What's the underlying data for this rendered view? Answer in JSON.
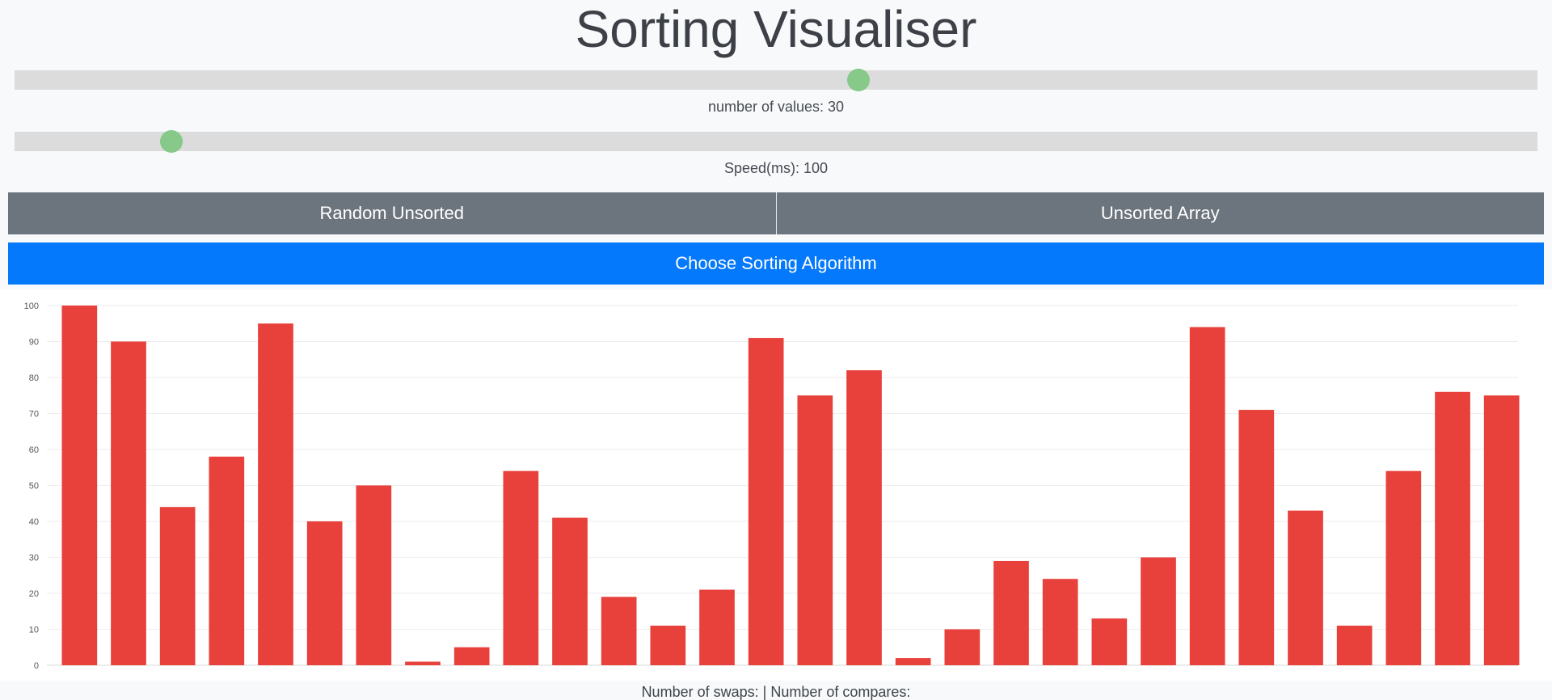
{
  "app": {
    "title": "Sorting Visualiser"
  },
  "controls": {
    "values_slider": {
      "caption_prefix": "number of values: ",
      "value": "30",
      "fraction": 0.555
    },
    "speed_slider": {
      "caption_prefix": "Speed(ms): ",
      "value": "100",
      "fraction": 0.097
    },
    "random_unsorted_label": "Random Unsorted",
    "unsorted_array_label": "Unsorted Array",
    "choose_algorithm_label": "Choose Sorting Algorithm"
  },
  "stats": {
    "swaps_label": "Number of swaps:",
    "separator": "|",
    "compares_label": "Number of compares:"
  },
  "colors": {
    "bar": "#e8403a",
    "slider_track": "#dcdcdc",
    "slider_thumb": "#86c988",
    "button_gray": "#6c757d",
    "button_blue": "#0579fb"
  },
  "chart_data": {
    "type": "bar",
    "ylim": [
      0,
      100
    ],
    "yticks": [
      0,
      10,
      20,
      30,
      40,
      50,
      60,
      70,
      80,
      90,
      100
    ],
    "grid": true,
    "values": [
      100,
      90,
      44,
      58,
      95,
      40,
      50,
      1,
      5,
      54,
      41,
      19,
      11,
      21,
      91,
      75,
      82,
      2,
      10,
      29,
      24,
      13,
      30,
      94,
      71,
      43,
      11,
      54,
      76,
      75
    ]
  }
}
